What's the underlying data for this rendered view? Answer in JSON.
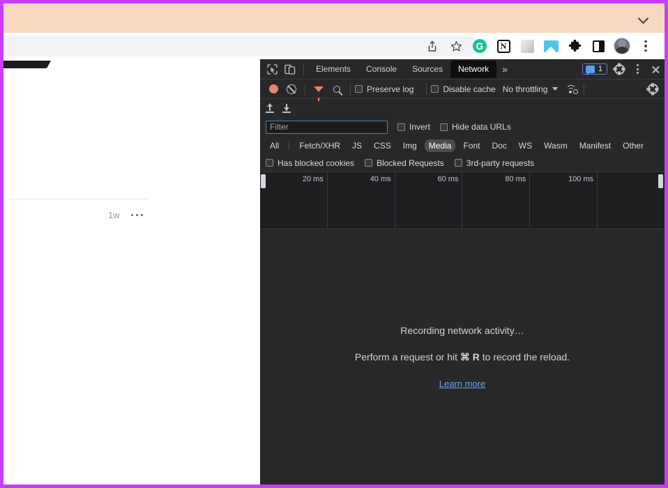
{
  "window": {
    "frame_color": "#c73ef5",
    "notification_bar": {
      "background": "#f9d8c1",
      "collapse_icon": "chevron-down-icon"
    }
  },
  "browser_toolbar": {
    "icons": [
      {
        "name": "share-icon",
        "glyph": "share"
      },
      {
        "name": "bookmark-star-icon",
        "glyph": "star"
      },
      {
        "name": "grammarly-extension-icon",
        "label": "G"
      },
      {
        "name": "notion-extension-icon",
        "label": "N"
      },
      {
        "name": "grayscale-extension-icon",
        "label": ""
      },
      {
        "name": "screenshot-extension-icon",
        "label": ""
      },
      {
        "name": "extensions-puzzle-icon",
        "label": "✦"
      },
      {
        "name": "side-panel-icon",
        "label": ""
      },
      {
        "name": "profile-avatar",
        "label": ""
      },
      {
        "name": "chrome-menu-icon",
        "label": ""
      }
    ]
  },
  "page": {
    "timestamp": "1w",
    "more_menu": "…"
  },
  "devtools": {
    "tabs": [
      {
        "label": "Elements",
        "active": false
      },
      {
        "label": "Console",
        "active": false
      },
      {
        "label": "Sources",
        "active": false
      },
      {
        "label": "Network",
        "active": true
      }
    ],
    "more_tabs_label": "»",
    "issues_count": "1",
    "toolbar": {
      "record_title": "record-button",
      "clear_title": "clear-button",
      "filter_title": "filter-button",
      "search_title": "search-button",
      "preserve_log_label": "Preserve log",
      "preserve_log_checked": false,
      "disable_cache_label": "Disable cache",
      "disable_cache_checked": false,
      "throttling_value": "No throttling"
    },
    "io_row": {
      "export_har_label": "export-har-icon",
      "import_har_label": "import-har-icon"
    },
    "filter_row": {
      "filter_placeholder": "Filter",
      "filter_value": "",
      "invert_label": "Invert",
      "invert_checked": false,
      "hide_data_urls_label": "Hide data URLs",
      "hide_data_urls_checked": false
    },
    "type_filters": [
      {
        "label": "All",
        "active": false
      },
      {
        "label": "Fetch/XHR",
        "active": false
      },
      {
        "label": "JS",
        "active": false
      },
      {
        "label": "CSS",
        "active": false
      },
      {
        "label": "Img",
        "active": false
      },
      {
        "label": "Media",
        "active": true
      },
      {
        "label": "Font",
        "active": false
      },
      {
        "label": "Doc",
        "active": false
      },
      {
        "label": "WS",
        "active": false
      },
      {
        "label": "Wasm",
        "active": false
      },
      {
        "label": "Manifest",
        "active": false
      },
      {
        "label": "Other",
        "active": false
      }
    ],
    "blocked_row": [
      {
        "label": "Has blocked cookies",
        "checked": false
      },
      {
        "label": "Blocked Requests",
        "checked": false
      },
      {
        "label": "3rd-party requests",
        "checked": false
      }
    ],
    "overview": {
      "ticks": [
        "20 ms",
        "40 ms",
        "60 ms",
        "80 ms",
        "100 ms"
      ]
    },
    "empty_state": {
      "line1": "Recording network activity…",
      "line2_pre": "Perform a request or hit ",
      "line2_key1": "⌘",
      "line2_key2": "R",
      "line2_post": " to record the reload.",
      "learn_more": "Learn more",
      "link_color": "#6ba5f0"
    }
  }
}
